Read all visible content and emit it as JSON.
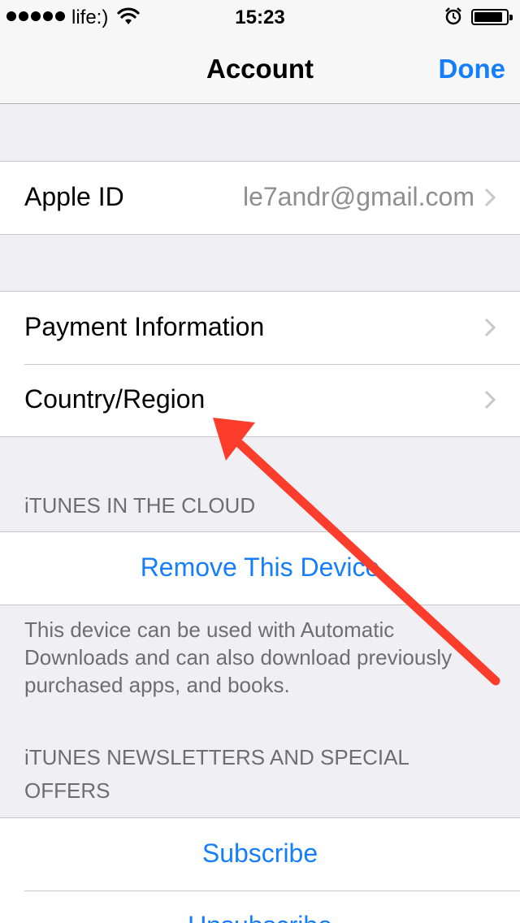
{
  "status_bar": {
    "carrier": "life:)",
    "time": "15:23",
    "icons": [
      "signal-dots",
      "wifi-icon",
      "alarm-icon",
      "battery-icon"
    ]
  },
  "nav": {
    "title": "Account",
    "done_label": "Done"
  },
  "apple_id": {
    "label": "Apple ID",
    "value": "le7andr@gmail.com"
  },
  "account_items": [
    {
      "label": "Payment Information"
    },
    {
      "label": "Country/Region"
    }
  ],
  "itunes_cloud": {
    "header": "iTUNES IN THE CLOUD",
    "remove_label": "Remove This Device",
    "footer": "This device can be used with Automatic Downloads and can also download previously purchased apps, and books."
  },
  "newsletters": {
    "header": "iTUNES NEWSLETTERS AND SPECIAL OFFERS",
    "subscribe_label": "Subscribe",
    "unsubscribe_label": "Unsubscribe"
  },
  "colors": {
    "accent": "#157efb",
    "background": "#efeff4",
    "annotation_arrow": "#fc3d2b"
  }
}
